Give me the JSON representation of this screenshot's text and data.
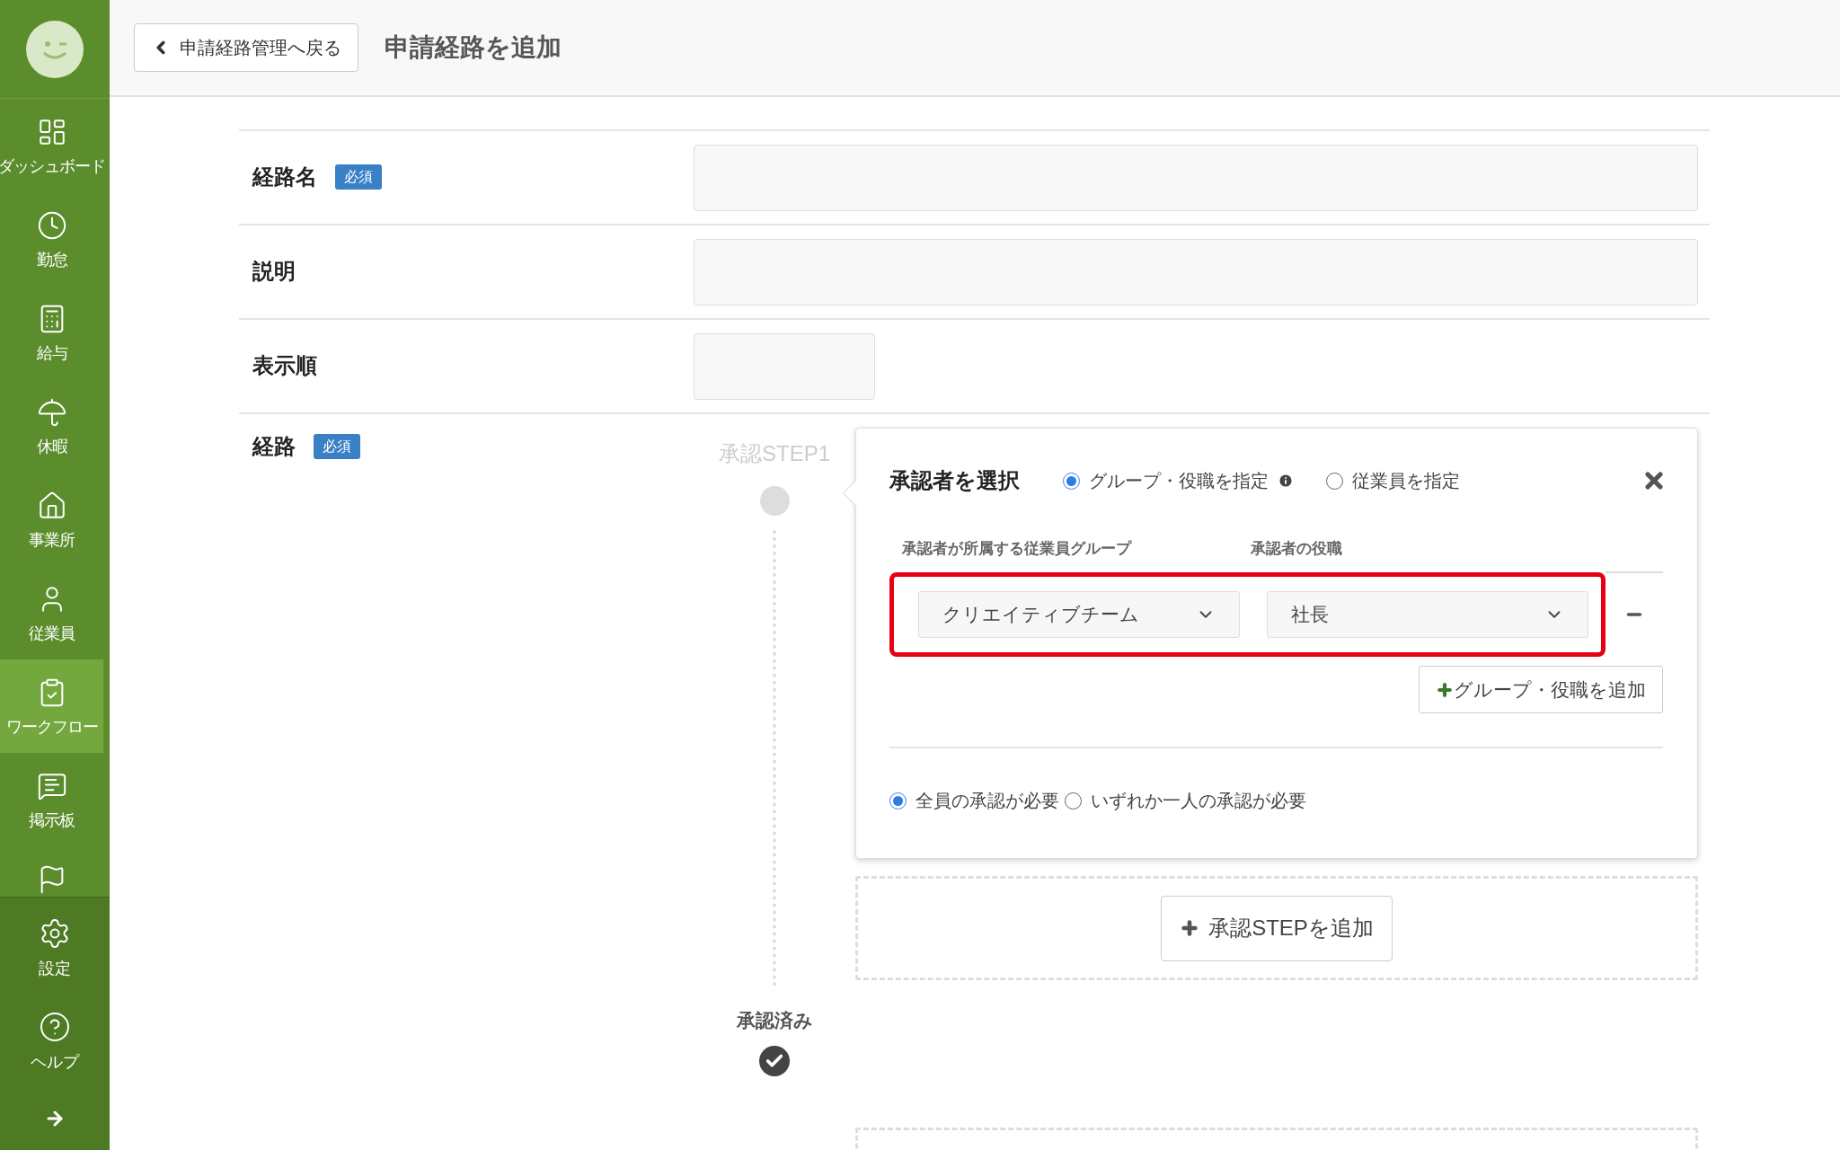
{
  "sidebar": {
    "items": [
      {
        "label": "ダッシュボード",
        "selected": false
      },
      {
        "label": "勤怠",
        "selected": false
      },
      {
        "label": "給与",
        "selected": false
      },
      {
        "label": "休暇",
        "selected": false
      },
      {
        "label": "事業所",
        "selected": false
      },
      {
        "label": "従業員",
        "selected": false
      },
      {
        "label": "ワークフロー",
        "selected": true
      },
      {
        "label": "掲示板",
        "selected": false
      },
      {
        "selected": false
      }
    ],
    "bottom_items": [
      {
        "label": "設定"
      },
      {
        "label": "ヘルプ"
      }
    ]
  },
  "header": {
    "back_button": "申請経路管理へ戻る",
    "title": "申請経路を追加"
  },
  "form": {
    "fields": [
      {
        "label": "経路名",
        "badge": "必須",
        "kind": "text"
      },
      {
        "label": "説明",
        "kind": "text"
      },
      {
        "label": "表示順",
        "kind": "short"
      }
    ],
    "route": {
      "label": "経路",
      "badge": "必須",
      "step_label": "承認STEP1",
      "done_label": "承認済み",
      "popup": {
        "title": "承認者を選択",
        "mode_options": [
          {
            "label": "グループ・役職を指定",
            "selected": true,
            "info": true
          },
          {
            "label": "従業員を指定",
            "selected": false,
            "info": false
          }
        ],
        "columns": [
          "承認者が所属する従業員グループ",
          "承認者の役職"
        ],
        "rows": [
          {
            "group": "クリエイティブチーム",
            "position": "社長",
            "highlighted": true
          }
        ],
        "add_button": "グループ・役職を追加",
        "approval_options": [
          {
            "label": "全員の承認が必要",
            "selected": true
          },
          {
            "label": "いずれか一人の承認が必要",
            "selected": false
          }
        ]
      },
      "add_step_button": "承認STEPを追加"
    }
  }
}
